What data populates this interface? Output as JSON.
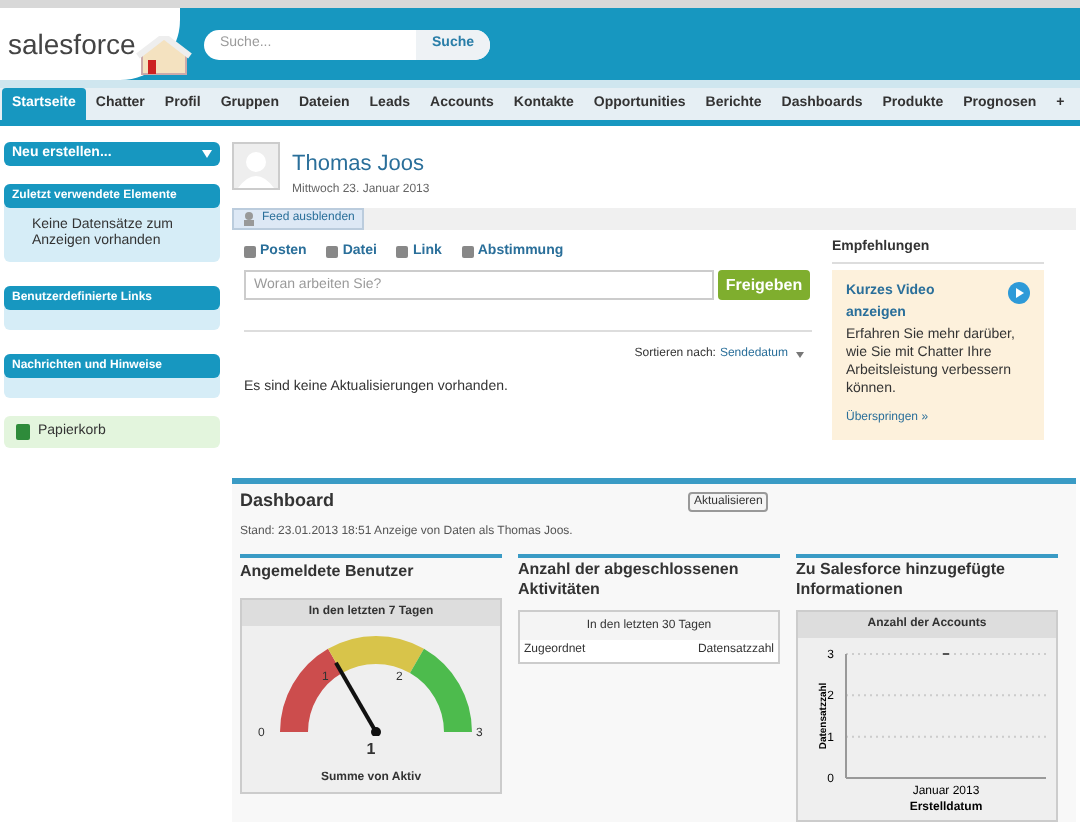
{
  "header": {
    "logo": "salesforce",
    "search": {
      "placeholder": "Suche..."
    },
    "search_button": "Suche"
  },
  "tabs": [
    {
      "label": "Startseite",
      "selected": true
    },
    {
      "label": "Chatter",
      "selected": false
    },
    {
      "label": "Profil",
      "selected": false
    },
    {
      "label": "Gruppen",
      "selected": false
    },
    {
      "label": "Dateien",
      "selected": false
    },
    {
      "label": "Leads",
      "selected": false
    },
    {
      "label": "Accounts",
      "selected": false
    },
    {
      "label": "Kontakte",
      "selected": false
    },
    {
      "label": "Opportunities",
      "selected": false
    },
    {
      "label": "Berichte",
      "selected": false
    },
    {
      "label": "Dashboards",
      "selected": false
    },
    {
      "label": "Produkte",
      "selected": false
    },
    {
      "label": "Prognosen",
      "selected": false
    },
    {
      "label": "+",
      "selected": false
    }
  ],
  "sidebar": {
    "create": "Neu erstellen...",
    "sections": [
      {
        "title": "Zuletzt verwendete Elemente",
        "text": "Keine Datensätze zum Anzeigen vorhanden"
      },
      {
        "title": "Benutzerdefinierte Links"
      },
      {
        "title": "Nachrichten und Hinweise"
      }
    ],
    "recycle_bin": "Papierkorb"
  },
  "profile": {
    "name": "Thomas Joos",
    "date": "Mittwoch 23. Januar 2013"
  },
  "feed": {
    "toggle": "Feed ausblenden",
    "actions": [
      "Posten",
      "Datei",
      "Link",
      "Abstimmung"
    ],
    "placeholder": "Woran arbeiten Sie?",
    "share": "Freigeben",
    "sort_label": "Sortieren nach:",
    "sort_value": "Sendedatum",
    "empty": "Es sind keine Aktualisierungen vorhanden."
  },
  "recommendations": {
    "title": "Empfehlungen",
    "card_title": "Kurzes Video anzeigen",
    "card_text": "Erfahren Sie mehr darüber, wie Sie mit Chatter Ihre Arbeitsleistung verbessern können.",
    "skip": "Überspringen »"
  },
  "dashboard": {
    "title": "Dashboard",
    "refresh": "Aktualisieren",
    "stand": "Stand: 23.01.2013 18:51 Anzeige von Daten als Thomas Joos.",
    "gauge": {
      "title": "Angemeldete Benutzer",
      "subtitle": "In den letzten 7 Tagen",
      "level": 0.333,
      "ticks": [
        "0",
        "1",
        "2",
        "3"
      ],
      "value": "1",
      "caption": "Summe von Aktiv"
    },
    "table": {
      "title": "Anzahl der abgeschlossenen Aktivitäten",
      "subtitle": "In den letzten 30 Tagen",
      "columns": [
        "Zugeordnet",
        "Datensatzzahl"
      ]
    },
    "accounts": {
      "title": "Zu Salesforce hinzugefügte Informationen",
      "chart_data": {
        "type": "scatter",
        "title": "Anzahl der Accounts",
        "xlabel": "Erstelldatum",
        "ylabel": "Datensatzzahl",
        "categories": [
          "Januar 2013"
        ],
        "values": [
          3
        ],
        "ylim": [
          0,
          3
        ],
        "yticks": [
          0,
          1,
          2,
          3
        ]
      }
    }
  }
}
